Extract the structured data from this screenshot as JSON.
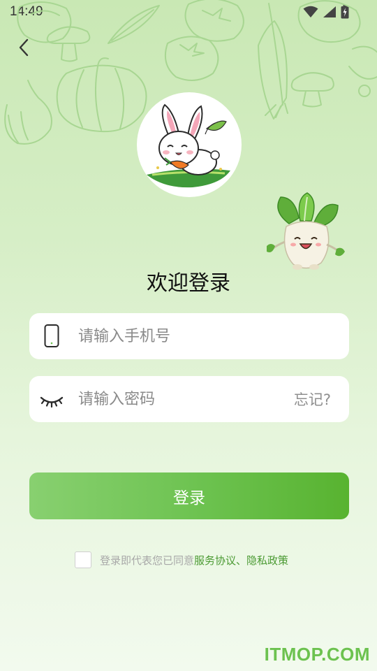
{
  "status_bar": {
    "time": "14:49",
    "icons": [
      "wifi-icon",
      "cellular-signal-icon",
      "battery-icon"
    ]
  },
  "header": {
    "back_icon": "chevron-left-icon"
  },
  "welcome": {
    "title": "欢迎登录"
  },
  "form": {
    "phone": {
      "icon": "phone-icon",
      "placeholder": "请输入手机号",
      "value": ""
    },
    "password": {
      "icon": "eye-closed-icon",
      "placeholder": "请输入密码",
      "value": "",
      "forgot_label": "忘记?"
    },
    "login_label": "登录"
  },
  "agreement": {
    "checked": false,
    "prefix": "登录即代表您已同意",
    "terms_label": "服务协议",
    "separator": "、",
    "privacy_label": "隐私政策"
  },
  "watermark": "ITMOP.COM",
  "colors": {
    "accent": "#6cc24f",
    "link": "#4a9a32",
    "background_top": "#c9e8b4",
    "background_bottom": "#f2faee"
  }
}
